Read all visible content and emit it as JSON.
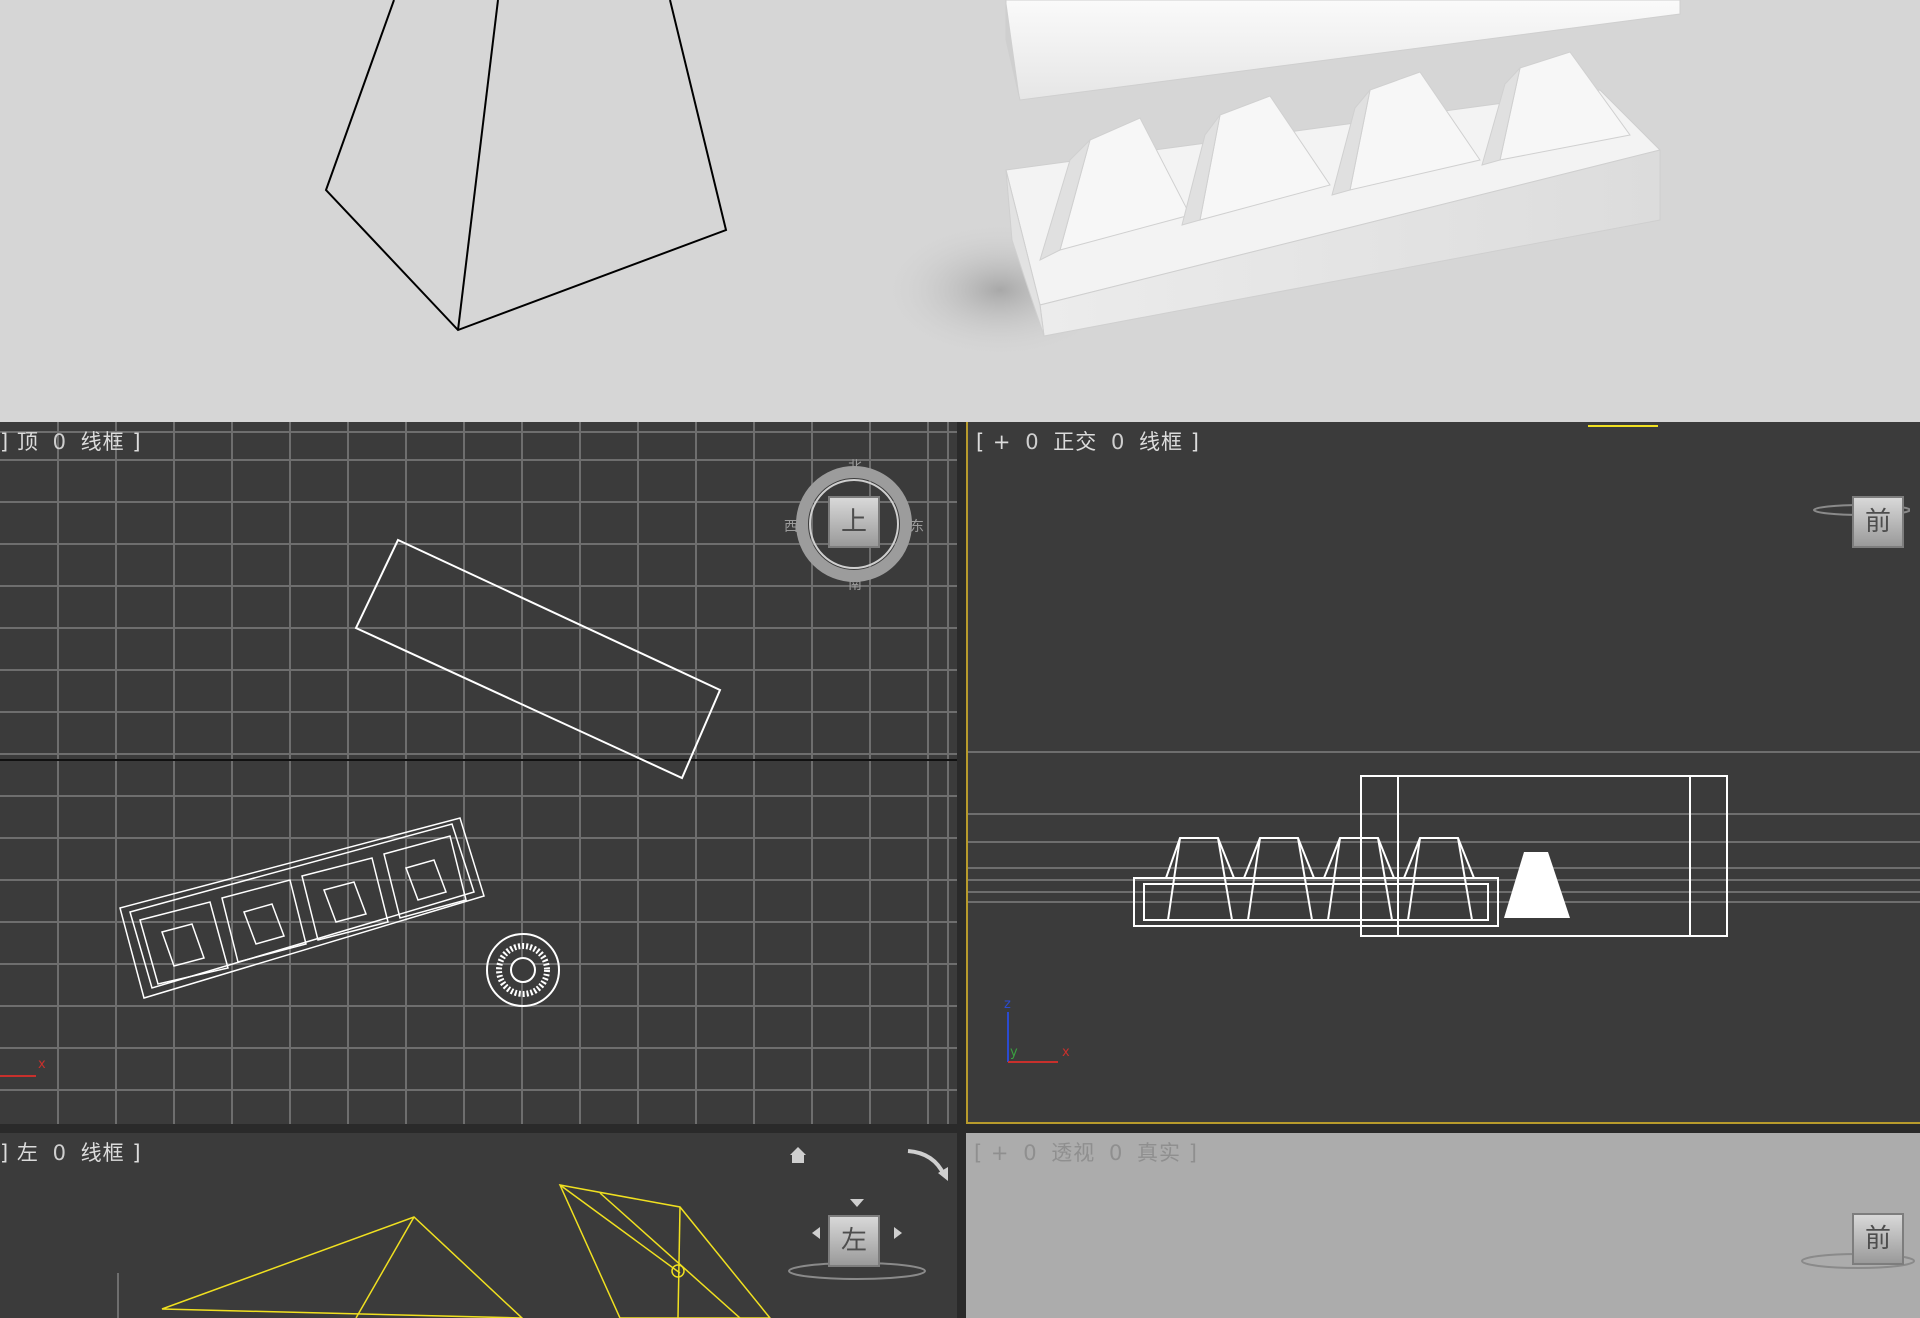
{
  "viewports": {
    "top": {
      "bracket_open": "]",
      "name": "顶",
      "sep": "0",
      "mode": "线框",
      "bracket_close": "]",
      "viewcube": {
        "face": "上",
        "n": "北",
        "s": "南",
        "w": "西",
        "e": "东"
      },
      "axis_x": "x"
    },
    "front": {
      "bracket_open": "[",
      "plus": "+",
      "sep1": "0",
      "name": "正交",
      "sep2": "0",
      "mode": "线框",
      "bracket_close": "]",
      "viewcube": {
        "face": "前"
      },
      "axis_z": "z",
      "axis_y": "y",
      "axis_x": "x"
    },
    "left": {
      "bracket_open": "]",
      "name": "左",
      "sep": "0",
      "mode": "线框",
      "bracket_close": "]",
      "viewcube": {
        "face": "左"
      }
    },
    "perspective": {
      "bracket_open": "[",
      "plus": "+",
      "sep1": "0",
      "name": "透视",
      "sep2": "0",
      "mode": "真实",
      "bracket_close": "]",
      "viewcube": {
        "face": "前"
      }
    }
  },
  "colors": {
    "render_bg": "#d6d6d6",
    "viewport_bg": "#3b3b3b",
    "grid": "#6e6e6e",
    "wireframe": "#ffffff",
    "selected": "#f0e020",
    "active_border": "#b79a2c",
    "perspective_bg": "#acacac"
  },
  "icons": [
    "home-icon",
    "rotate-arrow-icon",
    "viewcube-icon"
  ]
}
